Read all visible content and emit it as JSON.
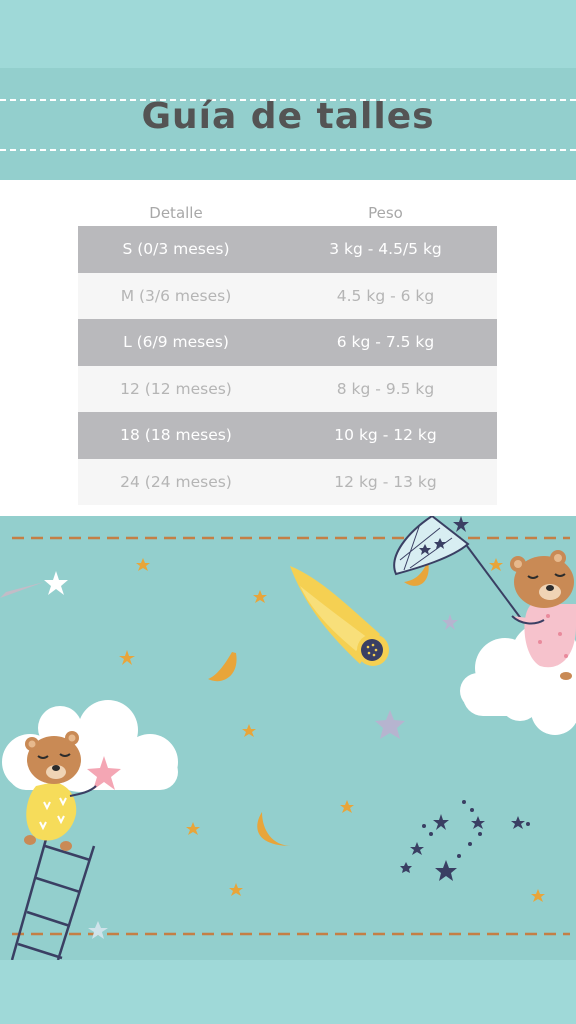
{
  "header": {
    "title": "Guía de talles"
  },
  "table": {
    "columns": [
      "Detalle",
      "Peso"
    ],
    "rows": [
      {
        "detalle": "S (0/3 meses)",
        "peso": "3 kg - 4.5/5 kg"
      },
      {
        "detalle": "M (3/6 meses)",
        "peso": "4.5 kg - 6 kg"
      },
      {
        "detalle": "L (6/9 meses)",
        "peso": "6 kg - 7.5 kg"
      },
      {
        "detalle": "12 (12 meses)",
        "peso": "8 kg - 9.5 kg"
      },
      {
        "detalle": "18 (18 meses)",
        "peso": "10 kg - 12 kg"
      },
      {
        "detalle": "24 (24 meses)",
        "peso": "12 kg - 13 kg"
      }
    ]
  },
  "colors": {
    "background": "#9fd9d8",
    "header": "#93cfcd",
    "title": "#545454",
    "row_dark": "#b9b9bc",
    "row_light": "#f6f6f6",
    "bear": "#c98a55",
    "star_orange": "#e8a53a",
    "moon_orange": "#e8a53a",
    "star_navy": "#3a3f63",
    "comet_yellow": "#f5d052"
  },
  "illustration": {
    "elements": [
      "bear-on-ladder",
      "bear-with-net",
      "cloud",
      "comet",
      "moon",
      "star",
      "constellation"
    ]
  }
}
